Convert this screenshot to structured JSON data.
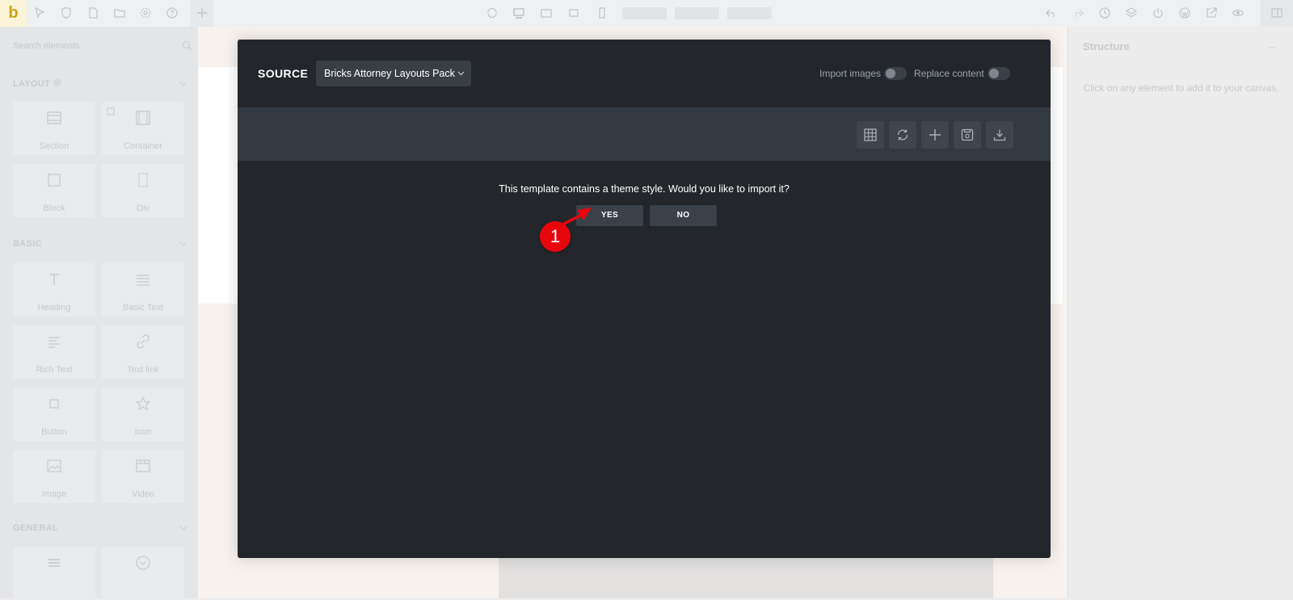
{
  "app": {
    "logo_letter": "b"
  },
  "toolbar": {
    "left_icons": [
      "cursor-icon",
      "shield-icon",
      "page-icon",
      "folder-icon",
      "gear-icon",
      "help-icon",
      "add-icon"
    ],
    "center_icons": [
      "refresh-icon",
      "desktop-icon",
      "tablet-landscape-icon",
      "tablet-icon",
      "mobile-icon"
    ],
    "right_icons": [
      "undo-icon",
      "redo-icon",
      "history-icon",
      "layers-icon",
      "power-icon",
      "wordpress-icon",
      "external-link-icon",
      "eye-icon",
      "panel-icon"
    ]
  },
  "left_panel": {
    "search_placeholder": "Search elements",
    "groups": [
      {
        "title": "LAYOUT",
        "elements": [
          {
            "label": "Section",
            "icon": "section-icon"
          },
          {
            "label": "Container",
            "icon": "container-icon"
          },
          {
            "label": "Block",
            "icon": "block-icon"
          },
          {
            "label": "Div",
            "icon": "div-icon"
          }
        ]
      },
      {
        "title": "BASIC",
        "elements": [
          {
            "label": "Heading",
            "icon": "heading-icon"
          },
          {
            "label": "Basic Text",
            "icon": "basic-text-icon"
          },
          {
            "label": "Rich Text",
            "icon": "rich-text-icon"
          },
          {
            "label": "Text link",
            "icon": "text-link-icon"
          },
          {
            "label": "Button",
            "icon": "button-icon"
          },
          {
            "label": "Icon",
            "icon": "star-icon"
          },
          {
            "label": "Image",
            "icon": "image-icon"
          },
          {
            "label": "Video",
            "icon": "video-icon"
          }
        ]
      },
      {
        "title": "GENERAL",
        "elements": []
      }
    ]
  },
  "right_panel": {
    "title": "Structure",
    "message": "Click on any element to add it to your canvas."
  },
  "modal": {
    "source_label": "SOURCE",
    "source_value": "Bricks Attorney Layouts Pack",
    "import_images_label": "Import images",
    "replace_content_label": "Replace content",
    "import_images_on": false,
    "replace_content_on": false,
    "bar_buttons": [
      "grid-icon",
      "sync-icon",
      "plus-icon",
      "save-icon",
      "download-icon"
    ],
    "prompt": "This template contains a theme style. Would you like to import it?",
    "yes_label": "YES",
    "no_label": "NO"
  },
  "annotation": {
    "number": "1",
    "color": "#e8060d"
  }
}
